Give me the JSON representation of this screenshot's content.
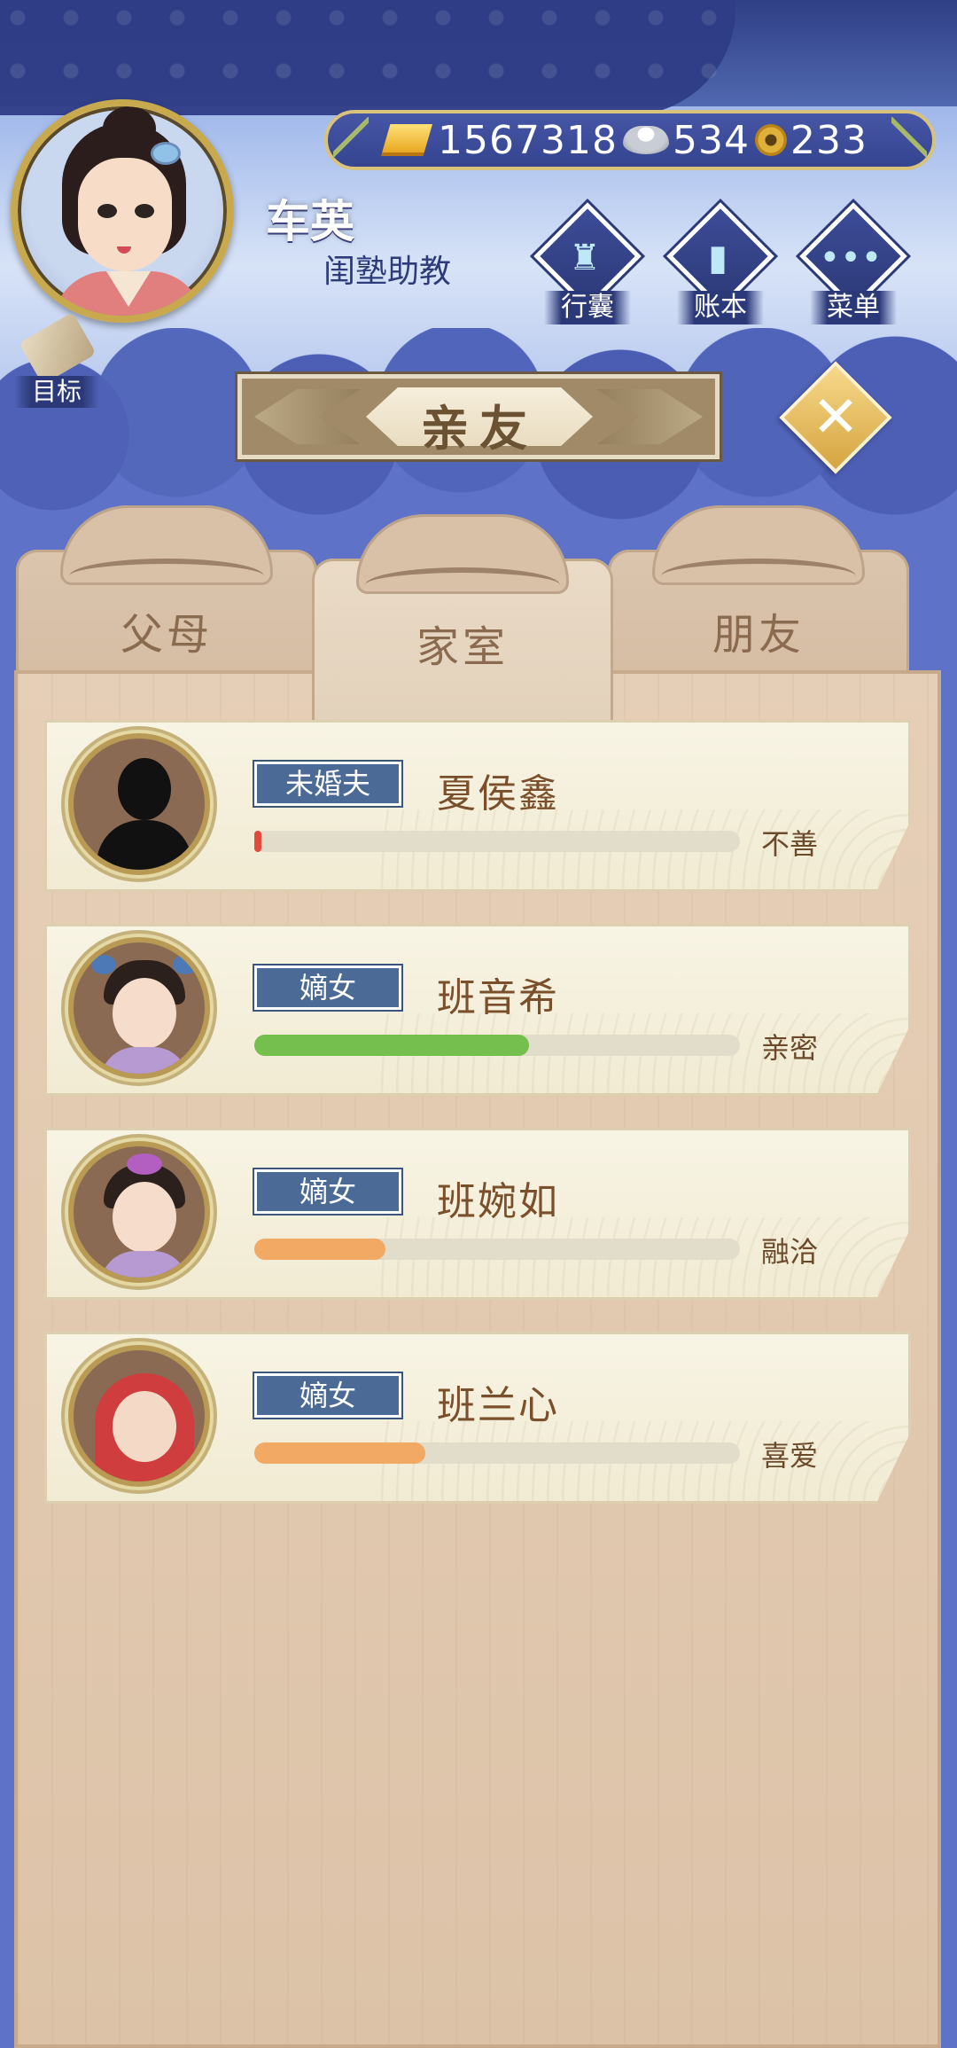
{
  "player": {
    "name": "车英",
    "title": "闺塾助教"
  },
  "currency": {
    "gold": "1567318",
    "silver": "534",
    "coin": "233"
  },
  "menu": {
    "bag_label": "行囊",
    "ledger_label": "账本",
    "menu_label": "菜单",
    "goal_label": "目标"
  },
  "page": {
    "title": "亲友"
  },
  "tabs": [
    {
      "label": "父母"
    },
    {
      "label": "家室"
    },
    {
      "label": "朋友"
    }
  ],
  "active_tab": "家室",
  "relations": [
    {
      "role": "未婚夫",
      "name": "夏侯鑫",
      "status": "不善",
      "affinity": 0.014,
      "bar_color": "#e24a3a"
    },
    {
      "role": "嫡女",
      "name": "班音希",
      "status": "亲密",
      "affinity": 0.565,
      "bar_color": "#74bf4d"
    },
    {
      "role": "嫡女",
      "name": "班婉如",
      "status": "融洽",
      "affinity": 0.27,
      "bar_color": "#f2a964"
    },
    {
      "role": "嫡女",
      "name": "班兰心",
      "status": "喜爱",
      "affinity": 0.353,
      "bar_color": "#f2a964"
    }
  ]
}
